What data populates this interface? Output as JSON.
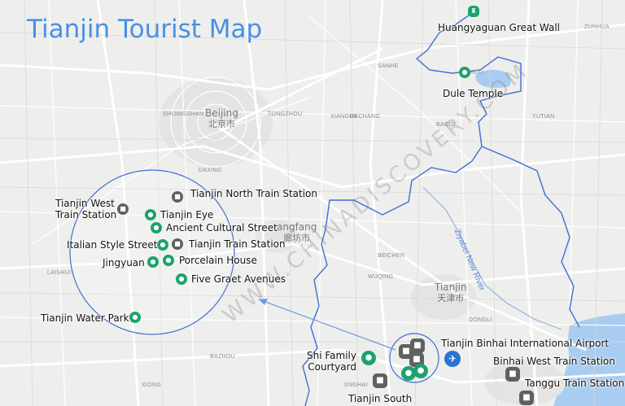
{
  "title": "Tianjin Tourist Map",
  "watermark": "WWW.CHINADISCOVERY.COM",
  "river": "Ziyabei New River",
  "cities": {
    "beijing_en": "Beijing",
    "beijing_cn": "北京市",
    "tianjin_en": "Tianjin",
    "tianjin_cn": "天津市",
    "langfang_en": "angfang",
    "langfang_cn": "廊坊市"
  },
  "districts": {
    "shijingshan": "SHIJINGSHAN",
    "tongzhou": "TONGZHOU",
    "xianghe": "XIANGHE",
    "jizhou": "JIZHOU",
    "zunhua": "ZUNHUA",
    "sanhe": "SANHE",
    "yutian": "YUTIAN",
    "dachang": "DACHANG",
    "baodi": "BAODI",
    "daxing": "DAXING",
    "beichen": "BEICHEN",
    "bazhou": "BAZHOU",
    "jinghai": "JINGHAI",
    "wuqing": "WUQING",
    "laishui": "LAISHUI",
    "xiong": "XIONG",
    "dongli": "DONGLI"
  },
  "pois": {
    "huangyaguan": "Huangyaguan Great Wall",
    "dule_temple": "Dule Temple",
    "tianjin_west": "Tianjin West\nTrain Station",
    "tianjin_north": "Tianjin North Train Station",
    "tianjin_eye": "Tianjin Eye",
    "ancient_street": "Ancient Cultural Street",
    "italian_street": "Italian Style Street",
    "tianjin_station": "Tianjin Train Station",
    "jingyuan": "Jingyuan",
    "porcelain_house": "Porcelain House",
    "five_avenues": "Five Graet Avenues",
    "water_park": "Tianjin Water Park",
    "binhai_airport": "Tianjin Binhai International Airport",
    "shi_family": "Shi Family\nCourtyard",
    "binhai_west": "Binhai West Train Station",
    "tanggu": "Tanggu Train Station",
    "tianjin_south": "Tianjin South"
  },
  "colors": {
    "title": "#4a8fe4",
    "boundary": "#3f6fd6",
    "attraction": "#1ba36b",
    "station": "#606060",
    "airport": "#2a72d4",
    "water": "#a9cdf0"
  },
  "icons": {
    "attraction": "camera-icon",
    "station": "train-icon",
    "airport": "plane-icon",
    "great_wall": "great-wall-icon"
  }
}
